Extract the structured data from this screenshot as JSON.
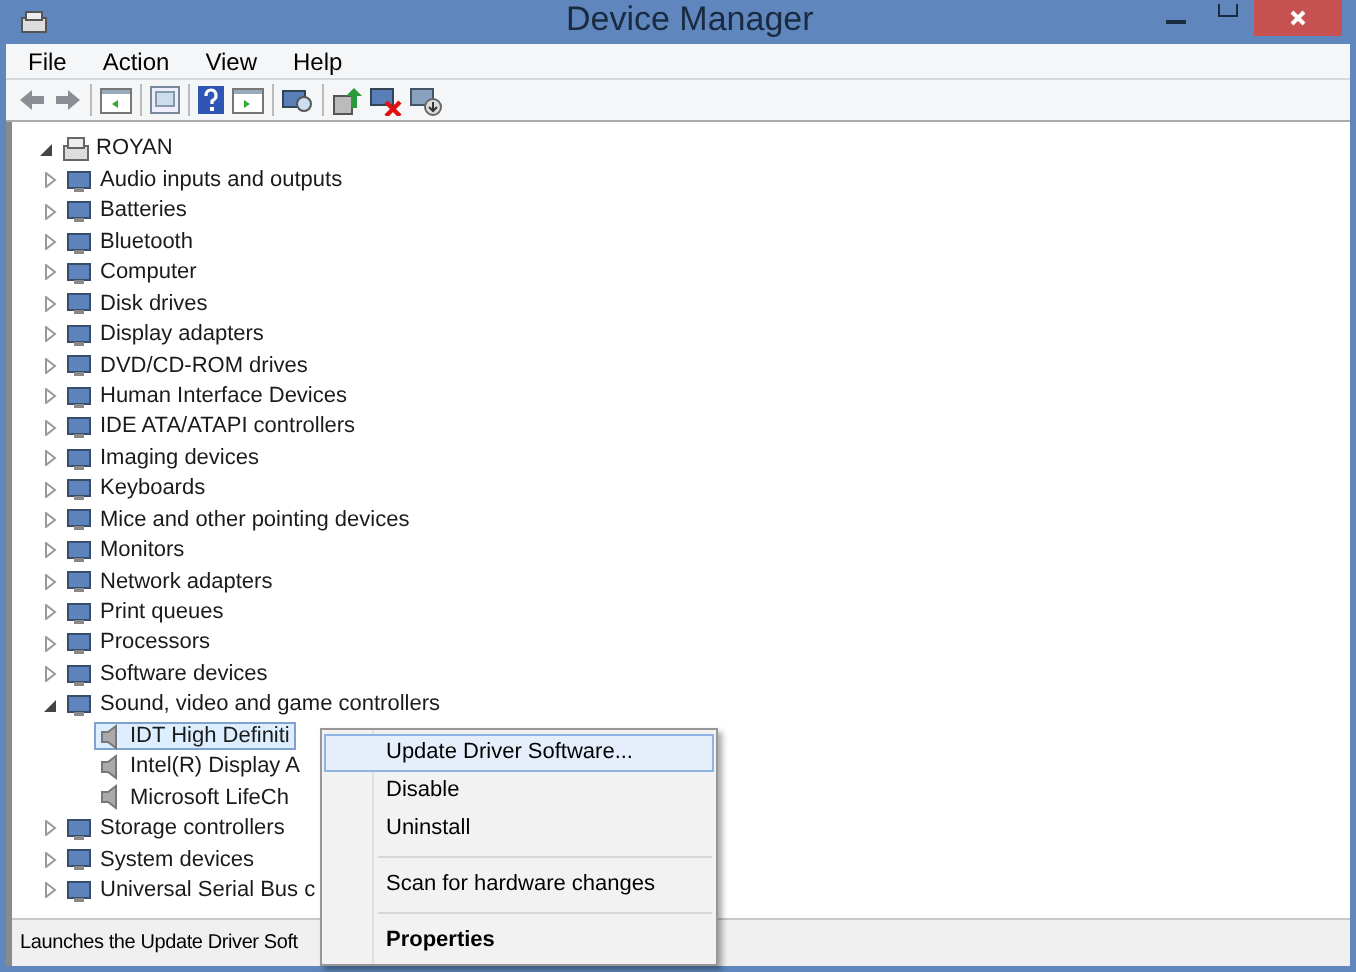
{
  "window": {
    "title": "Device Manager"
  },
  "menu_bar": [
    "File",
    "Action",
    "View",
    "Help"
  ],
  "tree": {
    "label": "ROYAN",
    "expanded": true,
    "selected": false,
    "children": [
      {
        "label": "Audio inputs and outputs",
        "expanded": false,
        "selected": false
      },
      {
        "label": "Batteries",
        "expanded": false,
        "selected": false
      },
      {
        "label": "Bluetooth",
        "expanded": false,
        "selected": false
      },
      {
        "label": "Computer",
        "expanded": false,
        "selected": false
      },
      {
        "label": "Disk drives",
        "expanded": false,
        "selected": false
      },
      {
        "label": "Display adapters",
        "expanded": false,
        "selected": false
      },
      {
        "label": "DVD/CD-ROM drives",
        "expanded": false,
        "selected": false
      },
      {
        "label": "Human Interface Devices",
        "expanded": false,
        "selected": false
      },
      {
        "label": "IDE ATA/ATAPI controllers",
        "expanded": false,
        "selected": false
      },
      {
        "label": "Imaging devices",
        "expanded": false,
        "selected": false
      },
      {
        "label": "Keyboards",
        "expanded": false,
        "selected": false
      },
      {
        "label": "Mice and other pointing devices",
        "expanded": false,
        "selected": false
      },
      {
        "label": "Monitors",
        "expanded": false,
        "selected": false
      },
      {
        "label": "Network adapters",
        "expanded": false,
        "selected": false
      },
      {
        "label": "Print queues",
        "expanded": false,
        "selected": false
      },
      {
        "label": "Processors",
        "expanded": false,
        "selected": false
      },
      {
        "label": "Software devices",
        "expanded": false,
        "selected": false
      },
      {
        "label": "Sound, video and game controllers",
        "expanded": true,
        "selected": false,
        "children": [
          {
            "label": "IDT High Definiti",
            "selected": true
          },
          {
            "label": "Intel(R) Display A",
            "selected": false
          },
          {
            "label": "Microsoft LifeCh",
            "selected": false
          }
        ]
      },
      {
        "label": "Storage controllers",
        "expanded": false,
        "selected": false
      },
      {
        "label": "System devices",
        "expanded": false,
        "selected": false
      },
      {
        "label": "Universal Serial Bus c",
        "expanded": false,
        "selected": false
      }
    ]
  },
  "context_menu": [
    {
      "kind": "item",
      "label": "Update Driver Software...",
      "selected": true
    },
    {
      "kind": "item",
      "label": "Disable",
      "selected": false
    },
    {
      "kind": "item",
      "label": "Uninstall",
      "selected": false
    },
    {
      "kind": "separator"
    },
    {
      "kind": "item",
      "label": "Scan for hardware changes",
      "selected": false
    },
    {
      "kind": "separator"
    },
    {
      "kind": "default",
      "label": "Properties",
      "selected": false
    }
  ],
  "status_bar": "Launches the Update Driver Soft"
}
